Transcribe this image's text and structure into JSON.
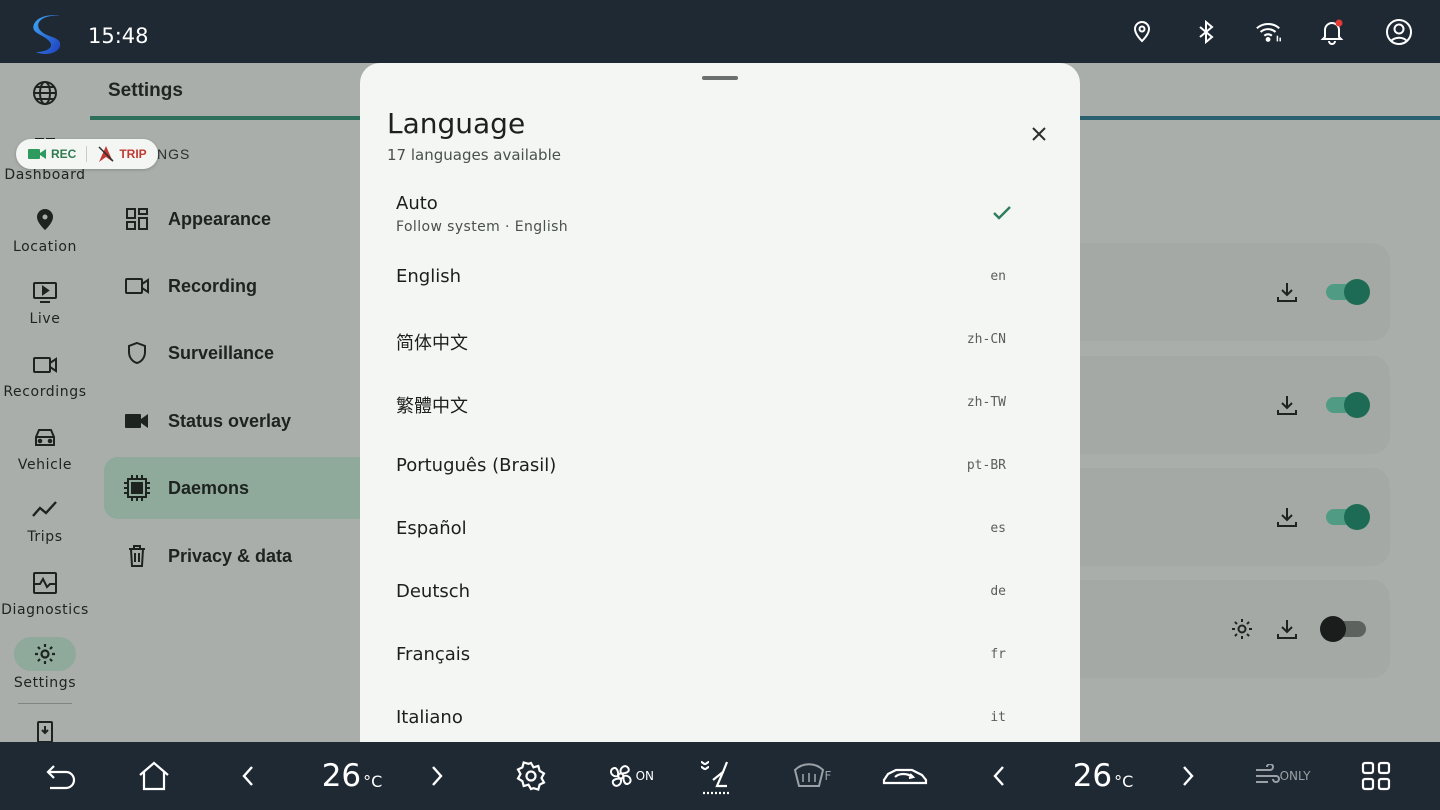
{
  "status_bar": {
    "time": "15:48",
    "icons": [
      "location-pin-icon",
      "bluetooth-icon",
      "wifi-icon",
      "notification-bell-icon",
      "account-icon"
    ],
    "notification_dot_color": "#e53935"
  },
  "nav_rail": {
    "items": [
      {
        "label": "Dashboard",
        "icon": "dashboard-icon"
      },
      {
        "label": "Location",
        "icon": "location-icon"
      },
      {
        "label": "Live",
        "icon": "live-icon"
      },
      {
        "label": "Recordings",
        "icon": "recordings-icon"
      },
      {
        "label": "Vehicle",
        "icon": "vehicle-icon"
      },
      {
        "label": "Trips",
        "icon": "trips-icon"
      },
      {
        "label": "Diagnostics",
        "icon": "diagnostics-icon"
      },
      {
        "label": "Settings",
        "icon": "settings-icon",
        "active": true
      }
    ]
  },
  "badge": {
    "rec_label": "REC",
    "trip_label": "TRIP"
  },
  "settings": {
    "title": "Settings",
    "section_header_visible": "NGS",
    "menu": [
      {
        "label": "Appearance",
        "icon": "appearance-icon"
      },
      {
        "label": "Recording",
        "icon": "recording-icon"
      },
      {
        "label": "Surveillance",
        "icon": "shield-icon"
      },
      {
        "label": "Status overlay",
        "icon": "camera-icon"
      },
      {
        "label": "Daemons",
        "icon": "chip-icon",
        "active": true
      },
      {
        "label": "Privacy & data",
        "icon": "trash-icon"
      }
    ],
    "daemon_cards": [
      {
        "enabled": true
      },
      {
        "enabled": true
      },
      {
        "enabled": true
      },
      {
        "enabled": false,
        "has_settings": true
      }
    ]
  },
  "dialog": {
    "title": "Language",
    "subtitle": "17 languages available",
    "auto": {
      "label": "Auto",
      "sub": "Follow system · English",
      "selected": true
    },
    "languages": [
      {
        "name": "English",
        "code": "en"
      },
      {
        "name": "简体中文",
        "code": "zh-CN"
      },
      {
        "name": "繁體中文",
        "code": "zh-TW"
      },
      {
        "name": "Português (Brasil)",
        "code": "pt-BR"
      },
      {
        "name": "Español",
        "code": "es"
      },
      {
        "name": "Deutsch",
        "code": "de"
      },
      {
        "name": "Français",
        "code": "fr"
      },
      {
        "name": "Italiano",
        "code": "it"
      }
    ],
    "accent": "#2e7d5b"
  },
  "bottom_bar": {
    "left_temp": "26",
    "right_temp": "26",
    "unit": "°C",
    "fan_label": "ON",
    "defrost_label": "F",
    "air_only_label": "ONLY"
  }
}
